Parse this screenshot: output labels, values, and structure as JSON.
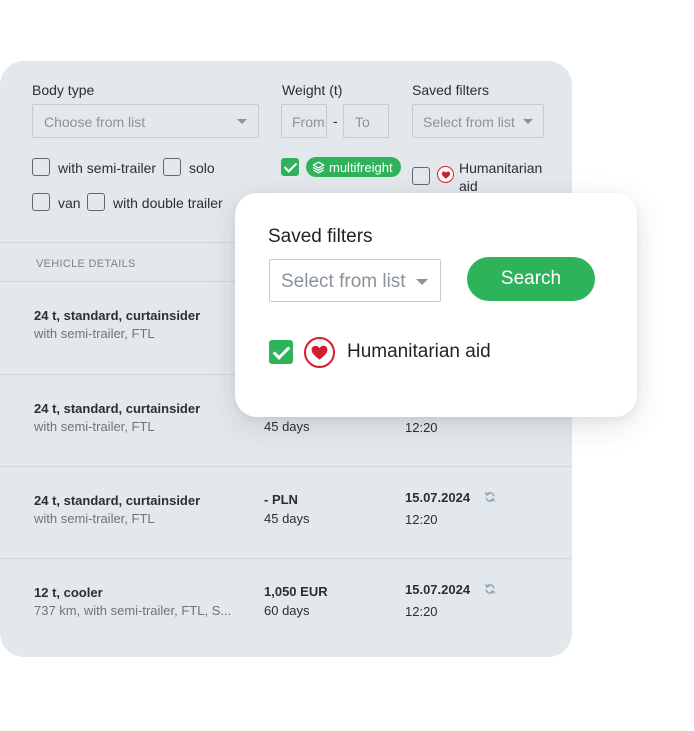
{
  "filters": {
    "body_type_label": "Body type",
    "body_type_placeholder": "Choose from list",
    "weight_label": "Weight (t)",
    "weight_from": "From",
    "weight_sep": "-",
    "weight_to": "To",
    "saved_filters_label": "Saved filters",
    "saved_filters_placeholder": "Select from list",
    "options": {
      "semi_trailer": "with semi-trailer",
      "solo": "solo",
      "van": "van",
      "double_trailer": "with double trailer",
      "multifreight": "multifreight",
      "humanitarian_line1": "Humanitarian",
      "humanitarian_line2": "aid"
    }
  },
  "table": {
    "header": "VEHICLE DETAILS",
    "rows": [
      {
        "title": "24 t, standard, curtainsider",
        "subtitle": "with semi-trailer, FTL",
        "price": "",
        "days": "",
        "date": "",
        "time": ""
      },
      {
        "title": "24 t, standard, curtainsider",
        "subtitle": "with semi-trailer, FTL",
        "price": "",
        "days": "45 days",
        "date": "",
        "time": "12:20"
      },
      {
        "title": "24 t, standard, curtainsider",
        "subtitle": "with semi-trailer, FTL",
        "price": "- PLN",
        "days": "45 days",
        "date": "15.07.2024",
        "time": "12:20"
      },
      {
        "title": "12 t, cooler",
        "subtitle": "737 km, with semi-trailer, FTL, S...",
        "price": "1,050 EUR",
        "days": "60 days",
        "date": "15.07.2024",
        "time": "12:20"
      }
    ]
  },
  "popup": {
    "title": "Saved filters",
    "select_placeholder": "Select from list",
    "search_label": "Search",
    "humanitarian_label": "Humanitarian aid",
    "humanitarian_checked": true
  },
  "colors": {
    "accent_green": "#2fb35a",
    "heart_red": "#d0202e",
    "panel_bg": "#e3e8ec"
  },
  "icons": {
    "layers": "layers-icon",
    "heart": "heart-icon",
    "refresh": "refresh-icon",
    "caret": "chevron-down-icon"
  }
}
